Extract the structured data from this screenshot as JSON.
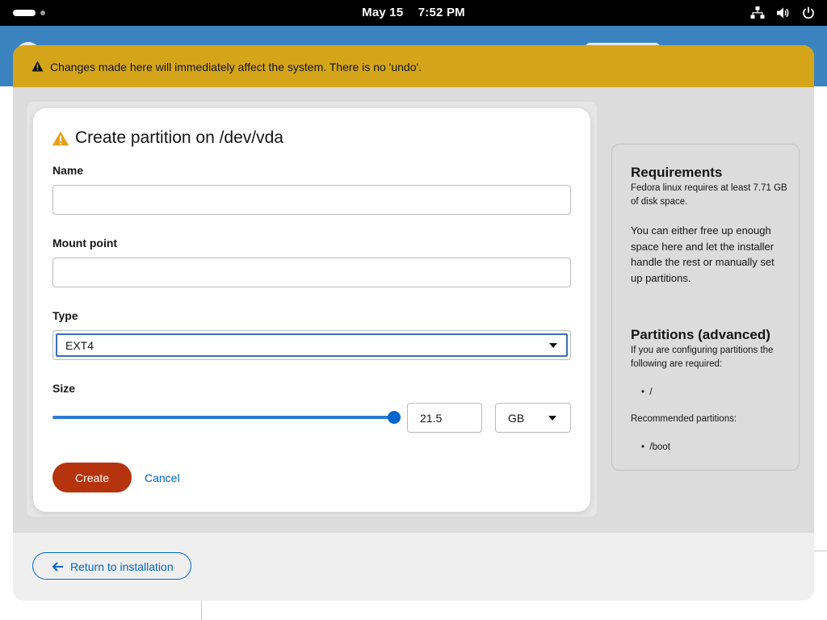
{
  "topbar": {
    "date": "May 15",
    "time": "7:52 PM",
    "icons": [
      "network-icon",
      "volume-icon",
      "power-icon"
    ]
  },
  "banner": {
    "text": "Changes made here will immediately affect the system. There is no 'undo'.",
    "icon": "warning-icon",
    "color": "#d4a519"
  },
  "dialog": {
    "title": "Create partition on /dev/vda",
    "name_label": "Name",
    "name_value": "",
    "mount_label": "Mount point",
    "mount_value": "",
    "type_label": "Type",
    "type_value": "EXT4",
    "size_label": "Size",
    "size_value": "21.5",
    "size_slider_fraction": 1.0,
    "unit_value": "GB",
    "create_label": "Create",
    "cancel_label": "Cancel"
  },
  "side": {
    "req_title": "Requirements",
    "req_small": "Fedora linux requires at least 7.71 GB of disk space.",
    "req_body": "You can either free up enough space here and let the installer handle the rest or manually set up partitions.",
    "adv_title": "Partitions (advanced)",
    "adv_small": "If you are configuring partitions the following are required:",
    "required": [
      "/"
    ],
    "recommended_label": "Recommended partitions:",
    "recommended": [
      "/boot"
    ]
  },
  "footer": {
    "return_label": "Return to installation"
  },
  "colors": {
    "accent": "#0066cc",
    "primary_button": "#b5340e",
    "warning": "#d4a519"
  }
}
